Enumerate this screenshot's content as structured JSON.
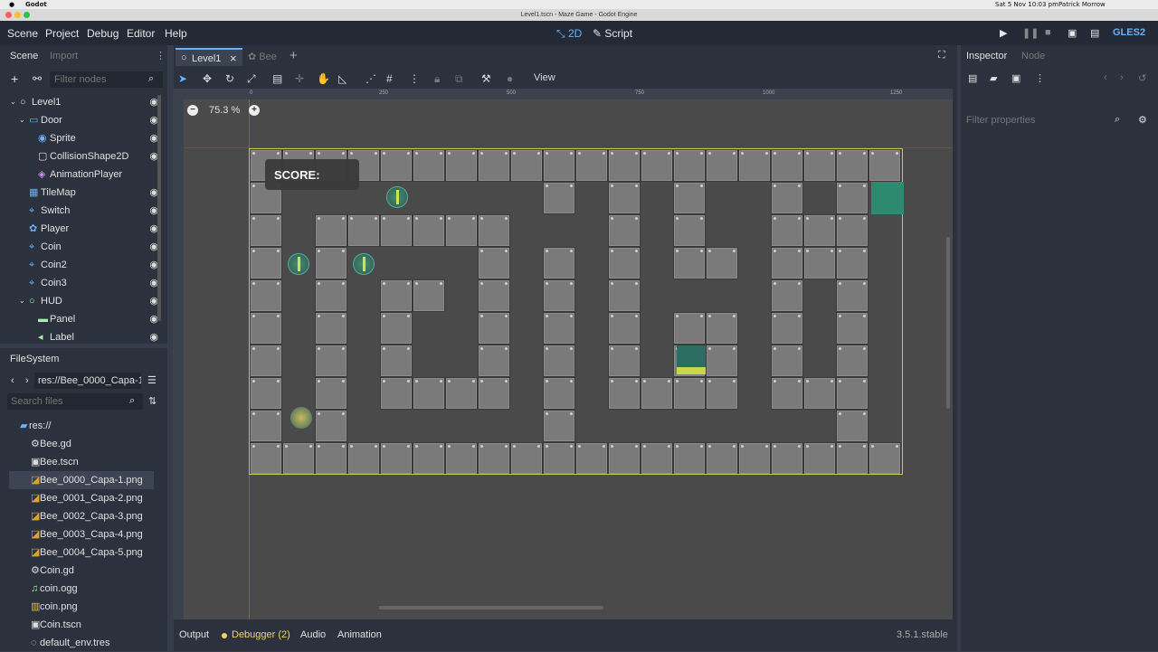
{
  "mac_menu": {
    "app": "Godot",
    "clock": "Sat 5 Nov  10:03 pm",
    "user": "Patrick Morrow"
  },
  "window_title": "Level1.tscn - Maze Game - Godot Engine",
  "menu": {
    "scene": "Scene",
    "project": "Project",
    "debug": "Debug",
    "editor": "Editor",
    "help": "Help"
  },
  "workspaces": {
    "two_d": "2D",
    "script": "Script"
  },
  "renderer": "GLES2",
  "scene_dock": {
    "tab_scene": "Scene",
    "tab_import": "Import",
    "filter_placeholder": "Filter nodes"
  },
  "scene_tree": [
    {
      "label": "Level1"
    },
    {
      "label": "Door"
    },
    {
      "label": "Sprite"
    },
    {
      "label": "CollisionShape2D"
    },
    {
      "label": "AnimationPlayer"
    },
    {
      "label": "TileMap"
    },
    {
      "label": "Switch"
    },
    {
      "label": "Player"
    },
    {
      "label": "Coin"
    },
    {
      "label": "Coin2"
    },
    {
      "label": "Coin3"
    },
    {
      "label": "HUD"
    },
    {
      "label": "Panel"
    },
    {
      "label": "Label"
    }
  ],
  "filesystem": {
    "title": "FileSystem",
    "path": "res://Bee_0000_Capa-1.",
    "search_placeholder": "Search files",
    "items": [
      {
        "label": "res://"
      },
      {
        "label": "Bee.gd"
      },
      {
        "label": "Bee.tscn"
      },
      {
        "label": "Bee_0000_Capa-1.png"
      },
      {
        "label": "Bee_0001_Capa-2.png"
      },
      {
        "label": "Bee_0002_Capa-3.png"
      },
      {
        "label": "Bee_0003_Capa-4.png"
      },
      {
        "label": "Bee_0004_Capa-5.png"
      },
      {
        "label": "Coin.gd"
      },
      {
        "label": "coin.ogg"
      },
      {
        "label": "coin.png"
      },
      {
        "label": "Coin.tscn"
      },
      {
        "label": "default_env.tres"
      }
    ]
  },
  "editor_tabs": {
    "level1": "Level1",
    "bee": "Bee"
  },
  "toolbar": {
    "view": "View"
  },
  "zoom": "75.3 %",
  "rulers": {
    "r0": "0",
    "r250": "250",
    "r500": "500",
    "r750": "750",
    "r1000": "1000",
    "r1250": "1250"
  },
  "hud": {
    "score": "SCORE:"
  },
  "inspector": {
    "tab_inspector": "Inspector",
    "tab_node": "Node",
    "filter_placeholder": "Filter properties"
  },
  "bottom_tabs": {
    "output": "Output",
    "debugger": "Debugger (2)",
    "audio": "Audio",
    "animation": "Animation"
  },
  "version": "3.5.1.stable",
  "colors": {
    "accent": "#6ab0f3",
    "debugger_dot": "#f4d35e",
    "selected_row": "#3d4554"
  }
}
